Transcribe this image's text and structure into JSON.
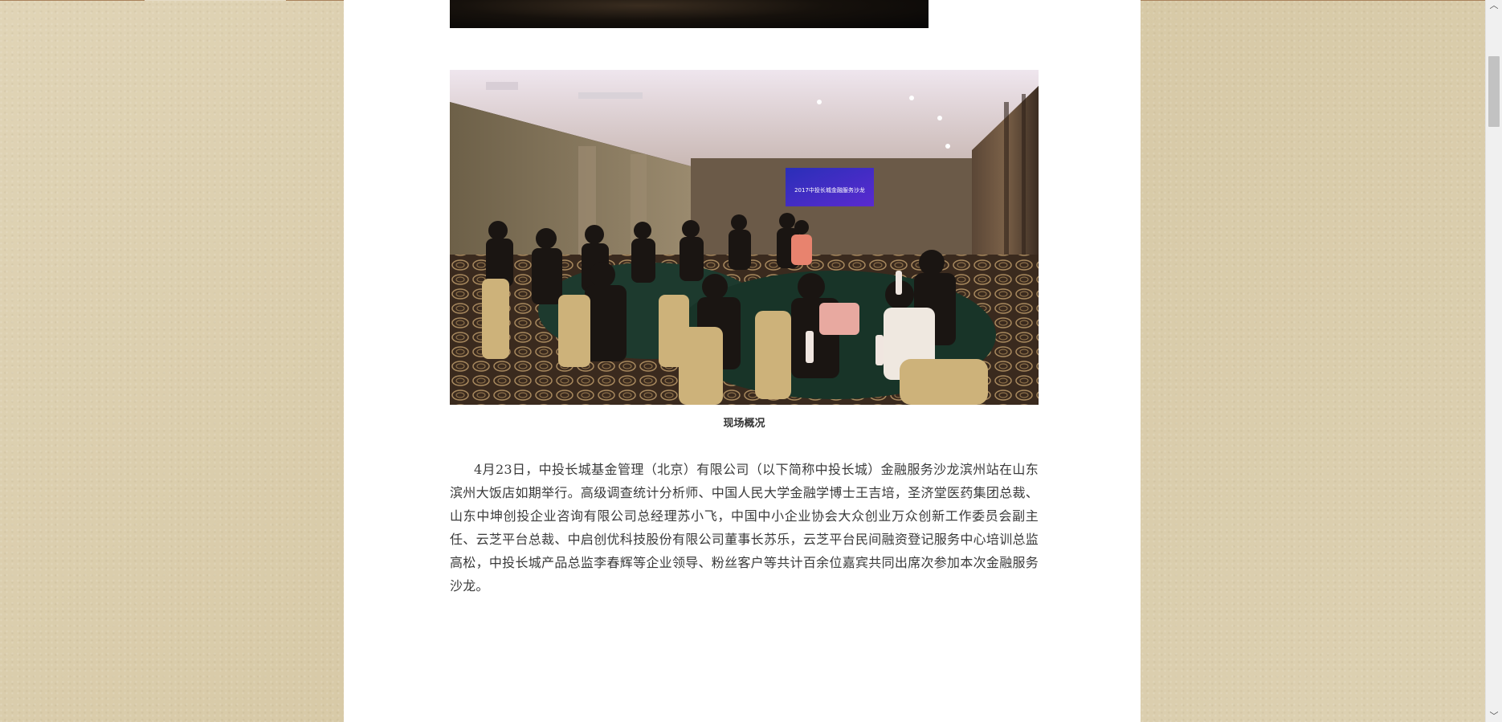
{
  "photo": {
    "screen_text": "2017中投长城金融服务沙龙"
  },
  "caption": "现场概况",
  "article": "4月23日，中投长城基金管理（北京）有限公司（以下简称中投长城）金融服务沙龙滨州站在山东滨州大饭店如期举行。高级调查统计分析师、中国人民大学金融学博士王吉培，圣济堂医药集团总裁、山东中坤创投企业咨询有限公司总经理苏小飞，中国中小企业协会大众创业万众创新工作委员会副主任、云芝平台总裁、中启创优科技股份有限公司董事长苏乐，云芝平台民间融资登记服务中心培训总监高松，中投长城产品总监李春辉等企业领导、粉丝客户等共计百余位嘉宾共同出席次参加本次金融服务沙龙。",
  "scrollbar": {
    "up_icon": "chevron-up-icon",
    "down_icon": "chevron-down-icon",
    "up_glyph": "︿",
    "down_glyph": "﹀"
  },
  "colors": {
    "background": "#ddd0b0",
    "paper": "#ffffff",
    "text": "#3a3a3a"
  }
}
